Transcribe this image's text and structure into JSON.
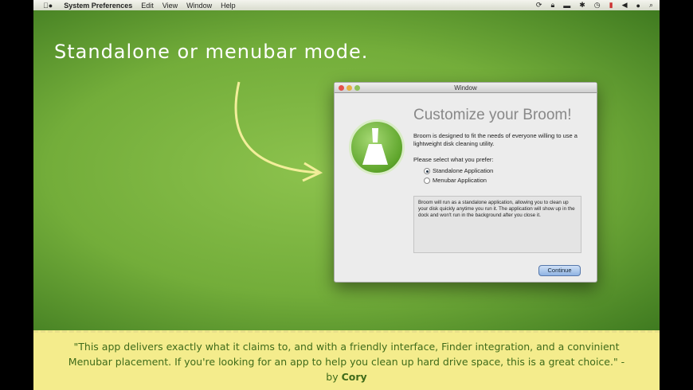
{
  "menubar": {
    "app": "System Preferences",
    "items": [
      "Edit",
      "View",
      "Window",
      "Help"
    ],
    "status_icons": [
      "sync-icon",
      "lock-icon",
      "display-icon",
      "bluetooth-icon",
      "time-machine-icon",
      "flag-icon",
      "volume-icon",
      "user-icon",
      "spotlight-icon"
    ]
  },
  "headline": "Standalone or menubar mode.",
  "window": {
    "title": "Window",
    "heading": "Customize your Broom!",
    "intro": "Broom is designed to fit the needs of everyone willing to use a lightweight disk cleaning utility.",
    "prompt": "Please select what you prefer:",
    "options": [
      {
        "label": "Standalone Application",
        "selected": true
      },
      {
        "label": "Menubar Application",
        "selected": false
      }
    ],
    "description": "Broom will run as a standalone application, allowing you to clean up your disk quickly anytime you run it. The application will show up in the dock and won't run in the background after you close it.",
    "continue": "Continue"
  },
  "quote": {
    "text": "\"This app delivers exactly what it claims to, and with a friendly interface, Finder integration, and a convinient Menubar placement. If you're looking for an app to help you clean up hard drive space, this is a great choice.\" - by ",
    "author": "Cory"
  }
}
